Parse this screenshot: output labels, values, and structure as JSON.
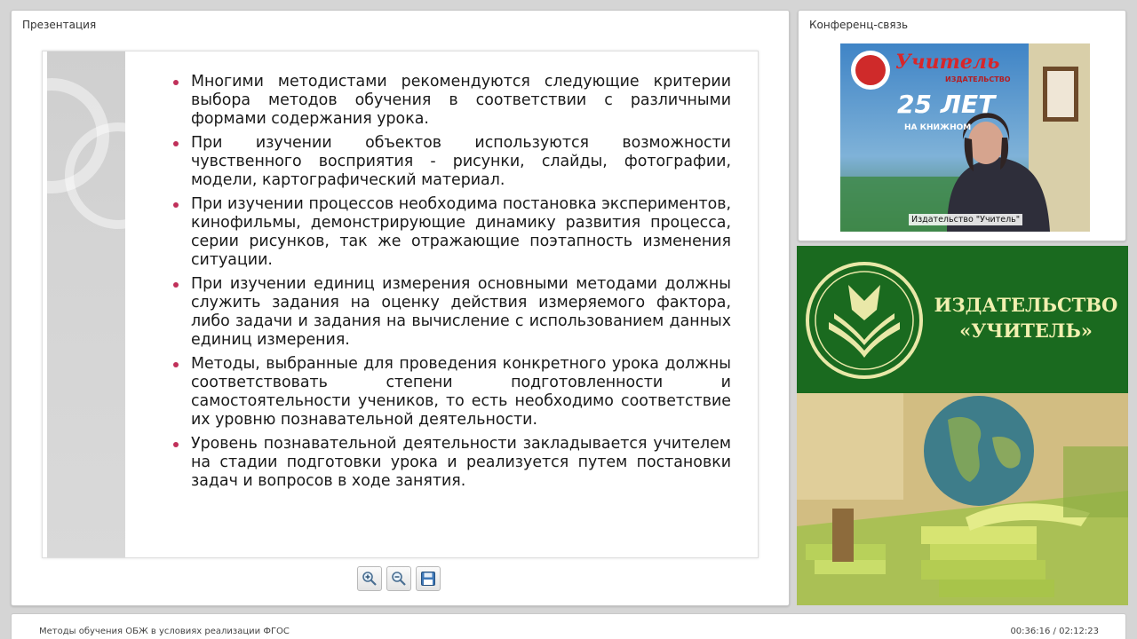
{
  "presentation": {
    "title": "Презентация",
    "slide_bullets": [
      "Многими методистами рекомендуются следующие критерии выбора методов обучения в соответствии с различными формами содержания урока.",
      "При изучении объектов используются возможности чувственного восприятия - рисунки, слайды, фотографии, модели, картографический материал.",
      "При изучении процессов необходима постановка экспериментов, кинофильмы, демонстрирующие динамику развития процесса, серии рисунков, так же отражающие поэтапность изменения ситуации.",
      "При изучении единиц измерения основными методами должны служить задания на оценку действия измеряемого фактора, либо задачи и задания на вычисление с использованием данных единиц измерения.",
      "Методы, выбранные для проведения конкретного урока должны соответствовать степени подготовленности и самостоятельности учеников, то есть необходимо соответствие их уровню познавательной деятельности.",
      "Уровень познавательной деятельности закладывается учителем на стадии подготовки урока и реализуется путем постановки задач и вопросов в ходе занятия."
    ],
    "toolbar": {
      "zoom_in_icon": "zoom-in-icon",
      "zoom_out_icon": "zoom-out-icon",
      "save_icon": "floppy-disk-icon"
    },
    "bullet_color": "#c0305a"
  },
  "conference": {
    "title": "Конференц-связь",
    "video_label": "Издательство \"Учитель\"",
    "backdrop_logo_text": "Учитель",
    "backdrop_subtitle": "ИЗДАТЕЛЬСТВО",
    "backdrop_years": "25 ЛЕТ",
    "backdrop_line": "НА КНИЖНОМ"
  },
  "banner": {
    "line1": "ИЗДАТЕЛЬСТВО",
    "line2": "«УЧИТЕЛЬ»",
    "brand_color": "#1a6a1f",
    "text_color": "#f2f0b0"
  },
  "footer": {
    "course_title": "Методы обучения ОБЖ в условиях реализации ФГОС",
    "time": "00:36:16 / 02:12:23"
  }
}
